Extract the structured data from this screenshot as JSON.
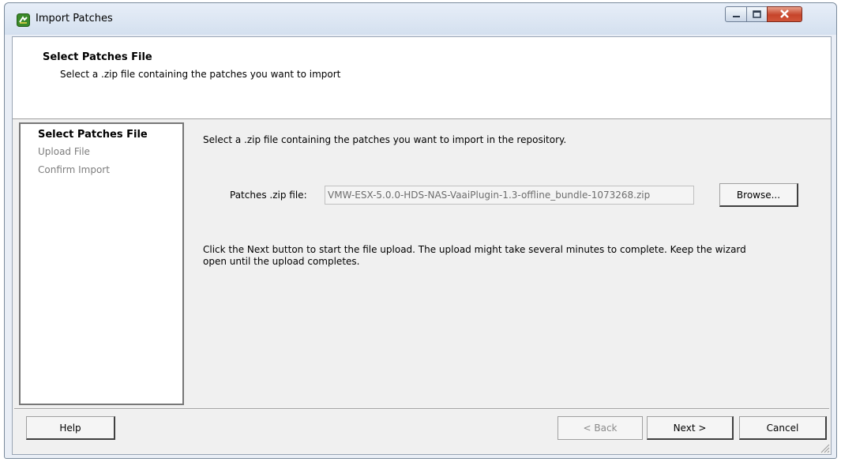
{
  "window": {
    "title": "Import Patches"
  },
  "header": {
    "title": "Select Patches File",
    "description": "Select a .zip file containing the patches you want to import"
  },
  "steps": [
    {
      "label": "Select Patches File",
      "active": true
    },
    {
      "label": "Upload File",
      "active": false
    },
    {
      "label": "Confirm Import",
      "active": false
    }
  ],
  "content": {
    "instruction": "Select a .zip file containing the patches you want to import in the repository.",
    "file_label": "Patches .zip file:",
    "file_value": "VMW-ESX-5.0.0-HDS-NAS-VaaiPlugin-1.3-offline_bundle-1073268.zip",
    "browse_label": "Browse...",
    "note": "Click the Next button to start the file upload. The upload might take several minutes to complete. Keep the wizard open until the upload completes."
  },
  "footer": {
    "help_label": "Help",
    "back_label": "< Back",
    "next_label": "Next >",
    "cancel_label": "Cancel"
  },
  "colors": {
    "titlebar": "#d4e0ef",
    "close_button": "#c6442a",
    "panel": "#f0f0f0"
  }
}
